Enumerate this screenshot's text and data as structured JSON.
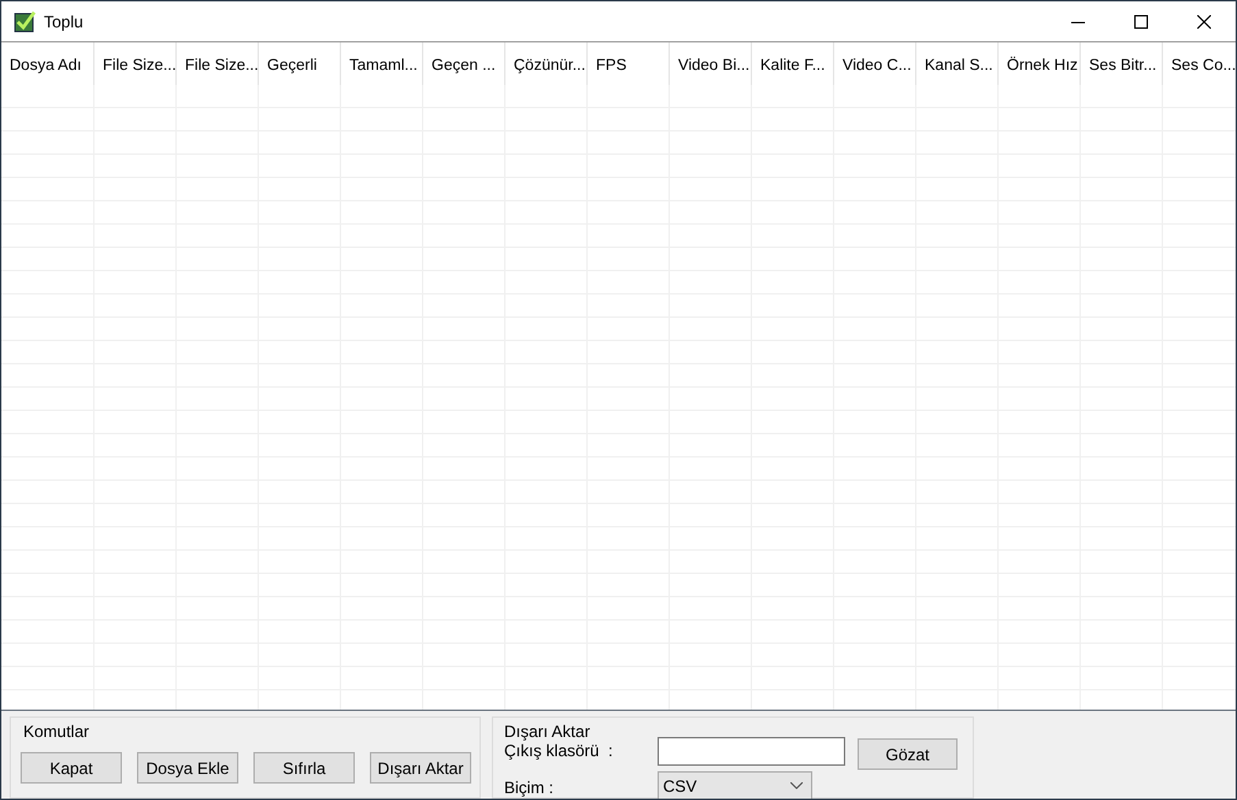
{
  "window": {
    "title": "Toplu"
  },
  "table": {
    "columns": [
      "Dosya Adı",
      "File Size...",
      "File Size...",
      "Geçerli",
      "Tamaml...",
      "Geçen ...",
      "Çözünür...",
      "FPS",
      "Video Bi...",
      "Kalite F...",
      "Video C...",
      "Kanal S...",
      "Örnek Hız",
      "Ses Bitr...",
      "Ses Co..."
    ]
  },
  "commands": {
    "title": "Komutlar",
    "buttons": [
      "Kapat",
      "Dosya Ekle",
      "Sıfırla",
      "Dışarı Aktar"
    ]
  },
  "export": {
    "title": "Dışarı Aktar",
    "output_label": "Çıkış klasörü  :",
    "browse_button": "Gözat",
    "format_label": "Biçim :",
    "format_value": "CSV"
  }
}
